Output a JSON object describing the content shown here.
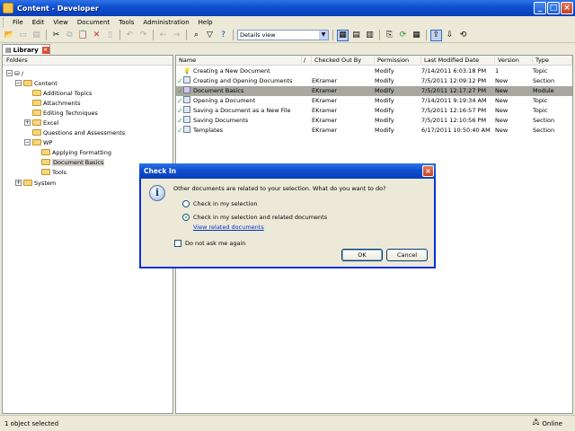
{
  "window": {
    "title": "Content - Developer"
  },
  "menubar": [
    "File",
    "Edit",
    "View",
    "Document",
    "Tools",
    "Administration",
    "Help"
  ],
  "toolbar": {
    "view_select": "Details view"
  },
  "tabs": [
    {
      "label": "Library"
    }
  ],
  "folders_panel": {
    "header": "Folders",
    "tree": [
      {
        "label": "/"
      },
      {
        "label": "Content"
      },
      {
        "label": "Additional Topics"
      },
      {
        "label": "Attachments"
      },
      {
        "label": "Editing Techniques"
      },
      {
        "label": "Excel"
      },
      {
        "label": "Questions and Assessments"
      },
      {
        "label": "WP"
      },
      {
        "label": "Applying Formatting"
      },
      {
        "label": "Document Basics"
      },
      {
        "label": "Tools"
      },
      {
        "label": "System"
      }
    ]
  },
  "list": {
    "columns": [
      "Name",
      "/",
      "Checked Out By",
      "Permission",
      "Last Modified Date",
      "Version",
      "Type"
    ],
    "rows": [
      {
        "name": "Creating a New Document",
        "checked_out_by": "",
        "permission": "Modify",
        "modified": "7/14/2011 6:03:18 PM",
        "version": "1",
        "type": "Topic"
      },
      {
        "name": "Creating and Opening Documents",
        "checked_out_by": "EKramer",
        "permission": "Modify",
        "modified": "7/5/2011 12:09:12 PM",
        "version": "New",
        "type": "Section"
      },
      {
        "name": "Document Basics",
        "checked_out_by": "EKramer",
        "permission": "Modify",
        "modified": "7/5/2011 12:17:27 PM",
        "version": "New",
        "type": "Module"
      },
      {
        "name": "Opening a Document",
        "checked_out_by": "EKramer",
        "permission": "Modify",
        "modified": "7/14/2011 9:19:34 AM",
        "version": "New",
        "type": "Topic"
      },
      {
        "name": "Saving a Document as a New File",
        "checked_out_by": "EKramer",
        "permission": "Modify",
        "modified": "7/5/2011 12:16:57 PM",
        "version": "New",
        "type": "Topic"
      },
      {
        "name": "Saving Documents",
        "checked_out_by": "EKramer",
        "permission": "Modify",
        "modified": "7/5/2011 12:10:56 PM",
        "version": "New",
        "type": "Section"
      },
      {
        "name": "Templates",
        "checked_out_by": "EKramer",
        "permission": "Modify",
        "modified": "6/17/2011 10:50:40 AM",
        "version": "New",
        "type": "Section"
      }
    ]
  },
  "dialog": {
    "title": "Check In",
    "message": "Other documents are related to your selection. What do you want to do?",
    "option1": "Check in my selection",
    "option2": "Check in my selection and related documents",
    "link": "View related documents",
    "checkbox": "Do not ask me again",
    "ok": "OK",
    "cancel": "Cancel"
  },
  "statusbar": {
    "left": "1 object selected",
    "right": "Online"
  }
}
